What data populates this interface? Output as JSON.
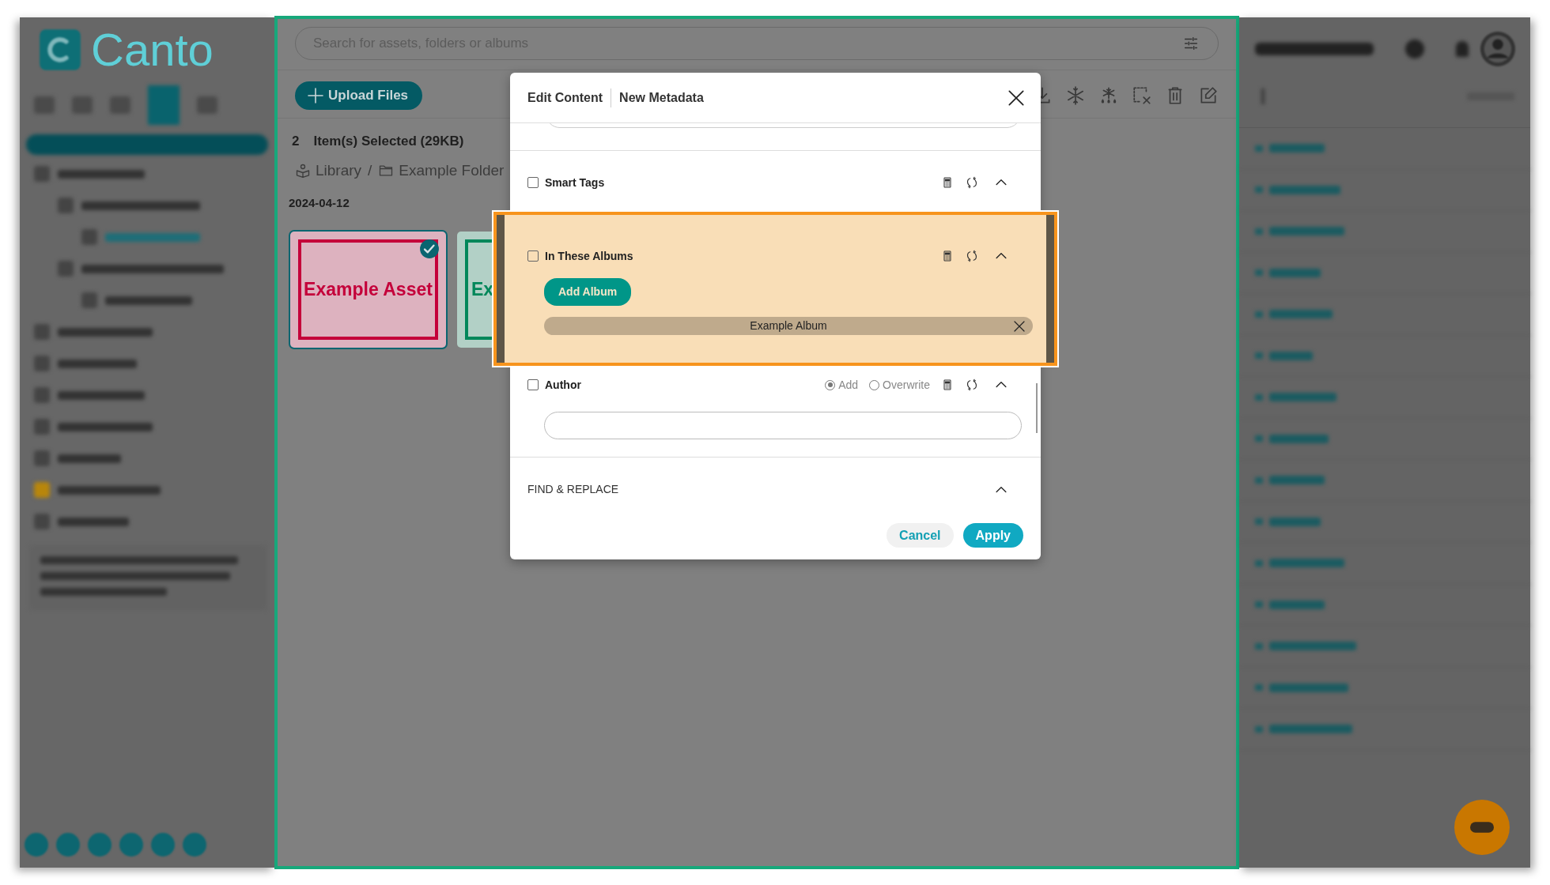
{
  "left_panel": {
    "logo": "Canto"
  },
  "search": {
    "placeholder": "Search for assets, folders or albums"
  },
  "upload_button": "Upload Files",
  "selection": {
    "count": "2",
    "label": "Item(s) Selected (29KB)"
  },
  "breadcrumbs": {
    "separator": "/",
    "items": [
      {
        "label": "Library"
      },
      {
        "label": "Example Folder"
      }
    ]
  },
  "date": "2024-04-12",
  "assets": [
    {
      "label": "Example Asset",
      "color": "#c4003a",
      "selected": true
    },
    {
      "label": "Ex",
      "color": "#00875a",
      "selected": false
    }
  ],
  "modal": {
    "tabs": [
      "Edit Content",
      "New Metadata"
    ],
    "fields": [
      {
        "kind": "tags",
        "label": "Smart Tags",
        "checked": false,
        "highlighted": false
      },
      {
        "kind": "albums",
        "label": "In These Albums",
        "checked": false,
        "highlighted": true,
        "add_button": "Add Album",
        "albums": [
          "Example Album"
        ]
      },
      {
        "kind": "text",
        "label": "Author",
        "checked": false,
        "highlighted": false,
        "modes": [
          {
            "label": "Add",
            "selected": true
          },
          {
            "label": "Overwrite",
            "selected": false
          }
        ]
      }
    ],
    "find_replace": "FIND & REPLACE",
    "buttons": [
      {
        "label": "Cancel",
        "kind": "secondary"
      },
      {
        "label": "Apply",
        "kind": "primary"
      }
    ]
  }
}
